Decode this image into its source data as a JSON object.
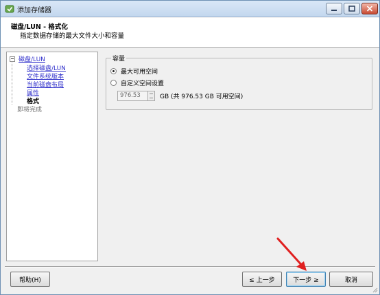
{
  "window": {
    "title": "添加存储器"
  },
  "header": {
    "title": "磁盘/LUN - 格式化",
    "subtitle": "指定数据存储的最大文件大小和容量"
  },
  "nav": {
    "root_label": "磁盘/LUN",
    "items": [
      {
        "label": "选择磁盘/LUN",
        "state": "link"
      },
      {
        "label": "文件系统版本",
        "state": "link"
      },
      {
        "label": "当前磁盘布局",
        "state": "link"
      },
      {
        "label": "属性",
        "state": "link"
      },
      {
        "label": "格式",
        "state": "current"
      }
    ],
    "pending": "即将完成"
  },
  "capacity": {
    "group_label": "容量",
    "options": [
      {
        "label": "最大可用空间",
        "checked": true
      },
      {
        "label": "自定义空间设置",
        "checked": false
      }
    ],
    "size_value": "976.53",
    "size_note": "GB (共 976.53 GB 可用空间)"
  },
  "footer": {
    "help_label": "帮助(H)",
    "back_label": "≤ 上一步",
    "next_label": "下一步 ≥",
    "cancel_label": "取消"
  },
  "colors": {
    "arrow": "#e02020",
    "link": "#3333cc",
    "accent": "#3c7fb1"
  }
}
